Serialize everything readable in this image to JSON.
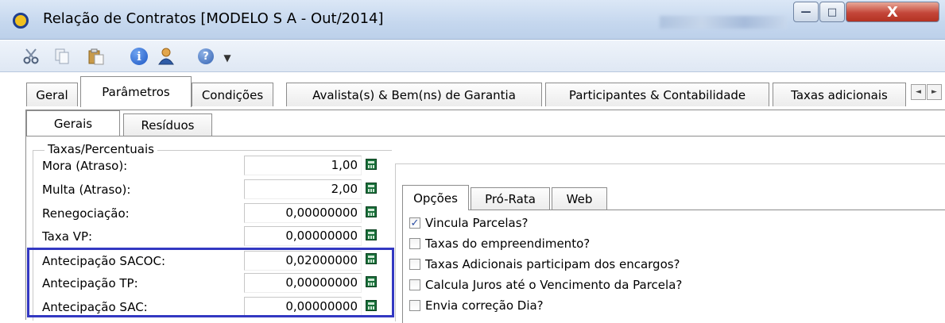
{
  "window": {
    "title": "Relação de Contratos [MODELO S A - Out/2014]",
    "min_glyph": "—",
    "max_glyph": "□",
    "close_glyph": "X"
  },
  "toolbar": {
    "icons": [
      "cut-icon",
      "copy-icon",
      "paste-icon",
      "info-icon",
      "user-icon",
      "help-icon",
      "dropdown-arrow-icon"
    ],
    "info_glyph": "i",
    "help_glyph": "?",
    "dropdown_glyph": "▼"
  },
  "main_tabs": [
    {
      "label": "Geral"
    },
    {
      "label": "Parâmetros",
      "active": true
    },
    {
      "label": "Condições"
    },
    {
      "label": "Avalista(s) & Bem(ns) de Garantia"
    },
    {
      "label": "Participantes & Contabilidade"
    },
    {
      "label": "Taxas adicionais"
    }
  ],
  "tab_scroll": {
    "left": "◄",
    "right": "►"
  },
  "sub_tabs": [
    {
      "label": "Gerais",
      "active": true
    },
    {
      "label": "Resíduos"
    }
  ],
  "rates_group": {
    "title": "Taxas/Percentuais",
    "fields": [
      {
        "label": "Mora (Atraso):",
        "value": "1,00"
      },
      {
        "label": "Multa (Atraso):",
        "value": "2,00"
      },
      {
        "label": "Renegociação:",
        "value": "0,00000000"
      },
      {
        "label": "Taxa VP:",
        "value": "0,00000000"
      },
      {
        "label": "Antecipação SACOC:",
        "value": "0,02000000"
      },
      {
        "label": "Antecipação TP:",
        "value": "0,00000000"
      },
      {
        "label": "Antecipação SAC:",
        "value": "0,00000000"
      }
    ]
  },
  "highlight_color": "#3338c2",
  "options_tabs": [
    {
      "label": "Opções",
      "active": true
    },
    {
      "label": "Pró-Rata"
    },
    {
      "label": "Web"
    }
  ],
  "options": [
    {
      "label": "Vincula Parcelas?",
      "checked": true
    },
    {
      "label": "Taxas do empreendimento?",
      "checked": false
    },
    {
      "label": "Taxas Adicionais participam dos encargos?",
      "checked": false
    },
    {
      "label": "Calcula Juros até o Vencimento da Parcela?",
      "checked": false
    },
    {
      "label": "Envia correção Dia?",
      "checked": false
    }
  ],
  "check_glyph": "✓"
}
